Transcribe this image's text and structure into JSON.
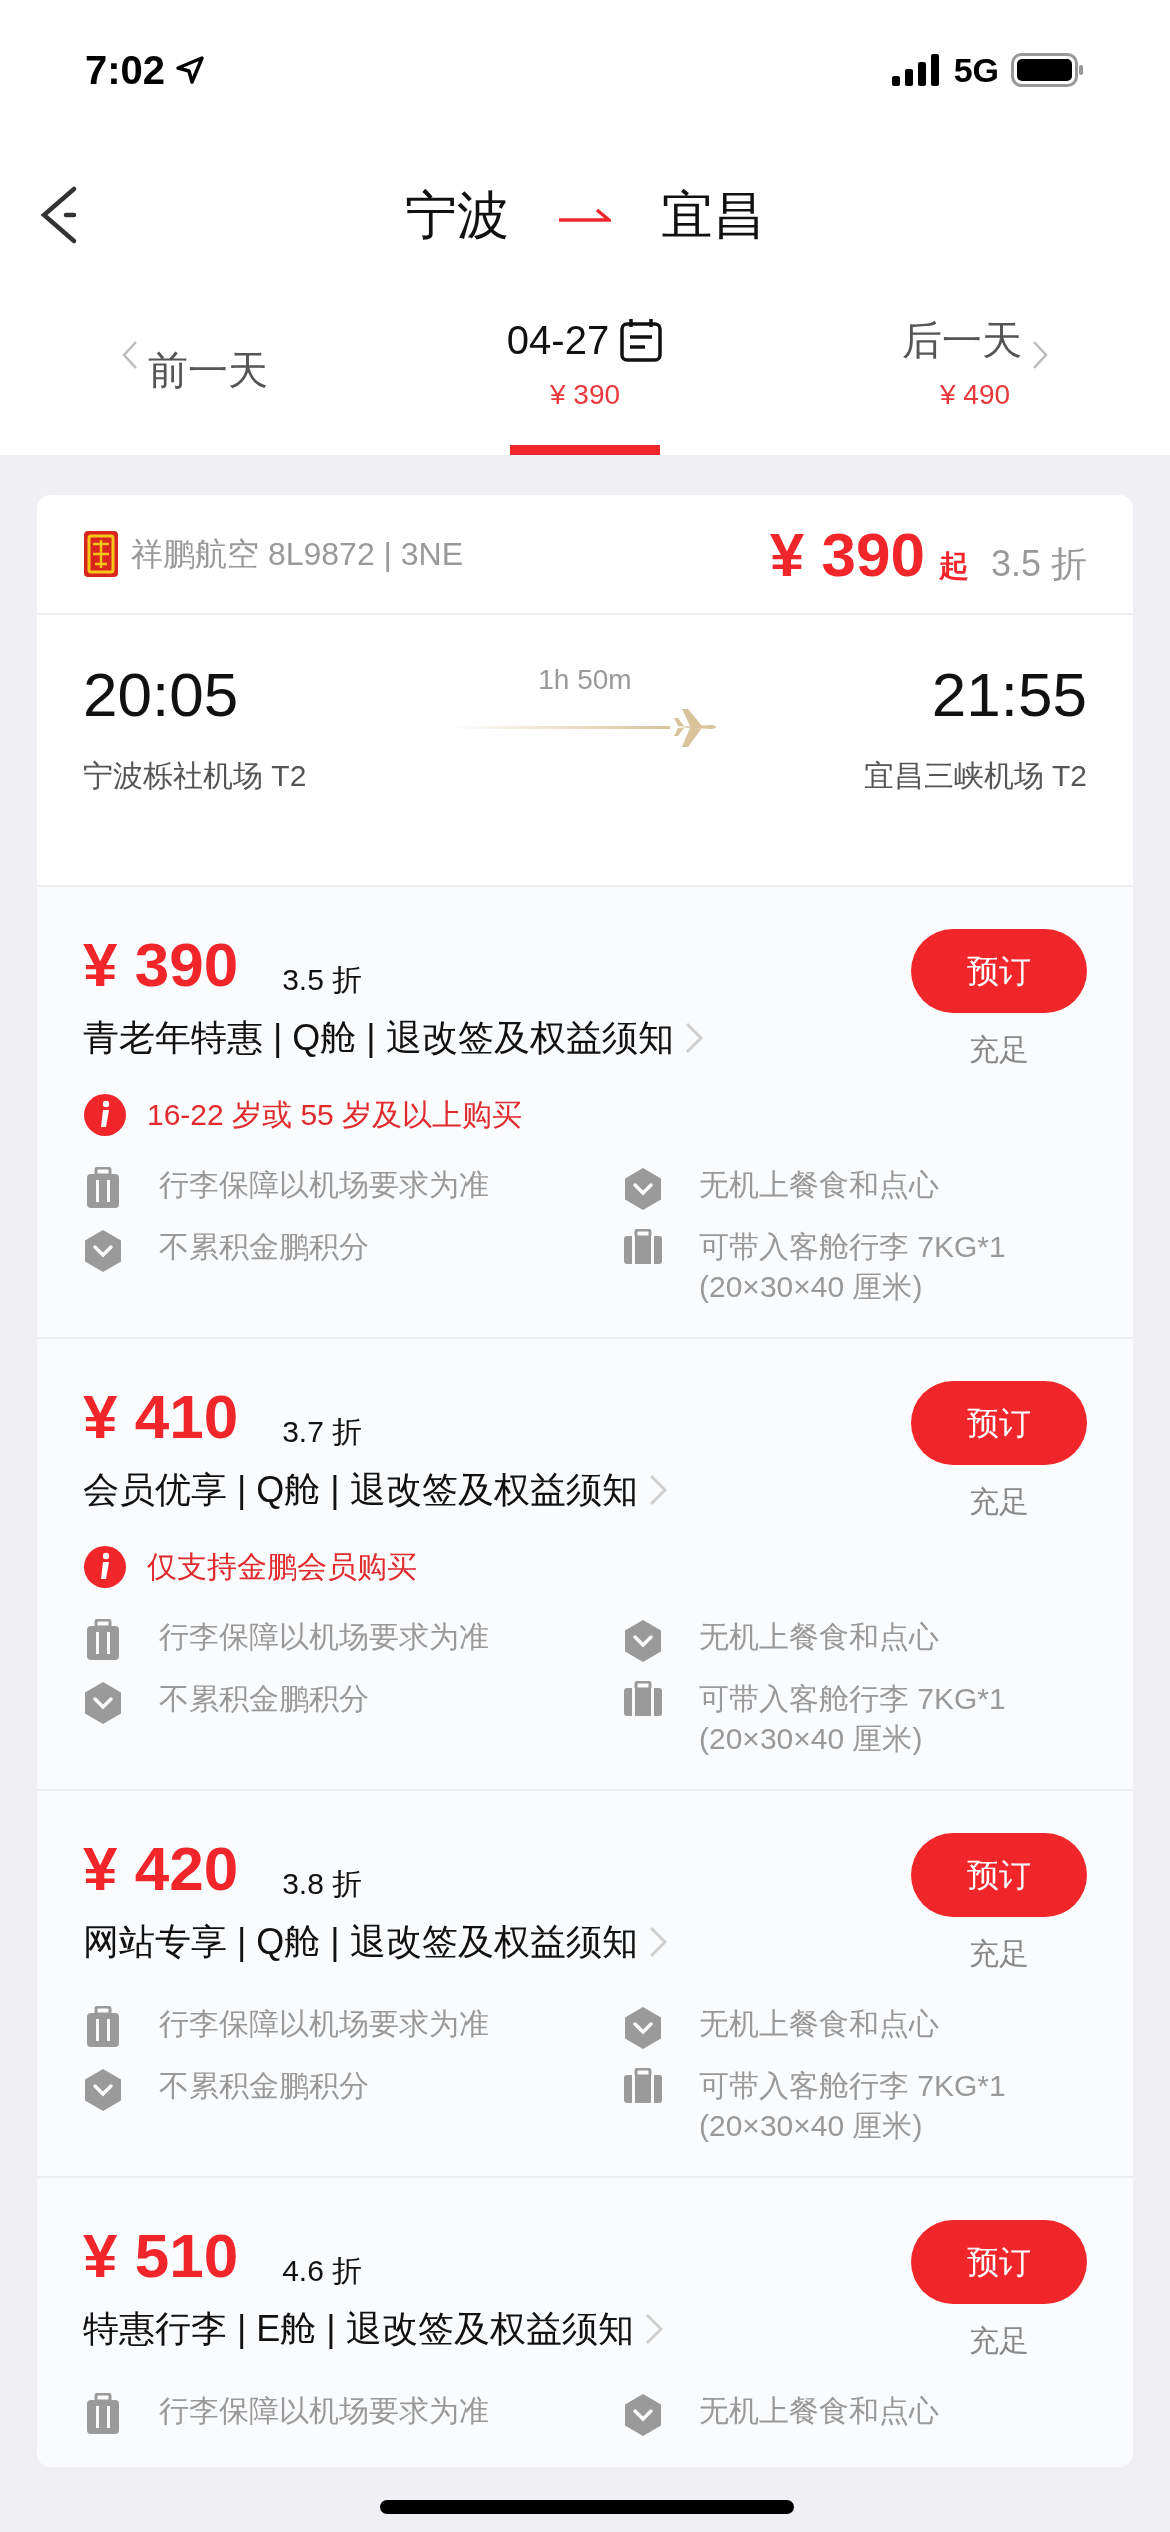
{
  "status_bar": {
    "time": "7:02",
    "network": "5G"
  },
  "header": {
    "from": "宁波",
    "to": "宜昌"
  },
  "date_tabs": [
    {
      "kind": "prev",
      "label": "前一天",
      "selected": false
    },
    {
      "kind": "current",
      "label": "04-27",
      "price": "¥ 390",
      "selected": true
    },
    {
      "kind": "next",
      "label": "后一天",
      "price": "¥ 490",
      "selected": false
    }
  ],
  "flight": {
    "airline": "祥鹏航空 8L9872 | 3NE",
    "price": "¥ 390",
    "price_suffix": "起",
    "discount": "3.5 折",
    "depart_time": "20:05",
    "arrive_time": "21:55",
    "duration": "1h 50m",
    "depart_airport": "宁波栎社机场 T2",
    "arrive_airport": "宜昌三峡机场 T2"
  },
  "fares": [
    {
      "price": "¥ 390",
      "discount": "3.5 折",
      "title": "青老年特惠 | Q舱 | 退改签及权益须知",
      "button": "预订",
      "availability": "充足",
      "notice": "16-22 岁或 55 岁及以上购买",
      "features": [
        {
          "kind": "luggage",
          "text": "行李保障以机场要求为准"
        },
        {
          "kind": "badge",
          "text": "无机上餐食和点心"
        },
        {
          "kind": "badge",
          "text": "不累积金鹏积分"
        },
        {
          "kind": "bag",
          "text": "可带入客舱行李 7KG*1",
          "detail": "(20×30×40 厘米)"
        }
      ]
    },
    {
      "price": "¥ 410",
      "discount": "3.7 折",
      "title": "会员优享 | Q舱 | 退改签及权益须知",
      "button": "预订",
      "availability": "充足",
      "notice": "仅支持金鹏会员购买",
      "features": [
        {
          "kind": "luggage",
          "text": "行李保障以机场要求为准"
        },
        {
          "kind": "badge",
          "text": "无机上餐食和点心"
        },
        {
          "kind": "badge",
          "text": "不累积金鹏积分"
        },
        {
          "kind": "bag",
          "text": "可带入客舱行李 7KG*1",
          "detail": "(20×30×40 厘米)"
        }
      ]
    },
    {
      "price": "¥ 420",
      "discount": "3.8 折",
      "title": "网站专享 | Q舱 | 退改签及权益须知",
      "button": "预订",
      "availability": "充足",
      "features": [
        {
          "kind": "luggage",
          "text": "行李保障以机场要求为准"
        },
        {
          "kind": "badge",
          "text": "无机上餐食和点心"
        },
        {
          "kind": "badge",
          "text": "不累积金鹏积分"
        },
        {
          "kind": "bag",
          "text": "可带入客舱行李 7KG*1",
          "detail": "(20×30×40 厘米)"
        }
      ]
    },
    {
      "price": "¥ 510",
      "discount": "4.6 折",
      "title": "特惠行李 | E舱 | 退改签及权益须知",
      "button": "预订",
      "availability": "充足",
      "features": [
        {
          "kind": "luggage",
          "text": "行李保障以机场要求为准"
        },
        {
          "kind": "badge",
          "text": "无机上餐食和点心"
        }
      ]
    }
  ]
}
